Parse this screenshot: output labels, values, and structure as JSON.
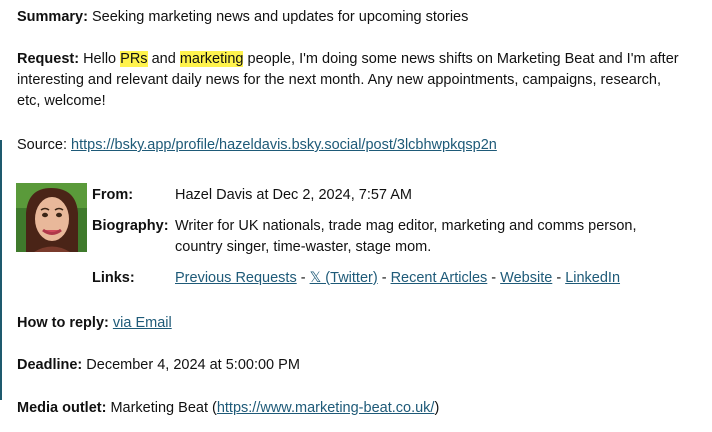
{
  "summary": {
    "label": "Summary:",
    "text": "Seeking marketing news and updates for upcoming stories"
  },
  "request": {
    "label": "Request:",
    "pre": "Hello ",
    "hl1": "PRs",
    "mid": " and ",
    "hl2": "marketing",
    "post": " people, I'm doing some news shifts on Marketing Beat and I'm after interesting and relevant daily news for the next month. Any new appointments, campaigns, research, etc, welcome!"
  },
  "source": {
    "label": "Source:",
    "url": "https://bsky.app/profile/hazeldavis.bsky.social/post/3lcbhwpkqsp2n"
  },
  "author": {
    "from_label": "From:",
    "from_value": "Hazel Davis at Dec 2, 2024, 7:57 AM",
    "bio_label": "Biography:",
    "bio_value": "Writer for UK nationals, trade mag editor, marketing and comms person, country singer, time-waster, stage mom.",
    "links_label": "Links:",
    "links": {
      "previous": "Previous Requests",
      "twitter": "𝕏 (Twitter)",
      "articles": "Recent Articles",
      "website": "Website",
      "linkedin": "LinkedIn",
      "sep": " - "
    }
  },
  "reply": {
    "label": "How to reply:",
    "link": "via Email"
  },
  "deadline": {
    "label": "Deadline:",
    "value": "December 4, 2024 at 5:00:00 PM"
  },
  "outlet": {
    "label": "Media outlet:",
    "name": "Marketing Beat (",
    "url": "https://www.marketing-beat.co.uk/",
    "close": ")"
  }
}
